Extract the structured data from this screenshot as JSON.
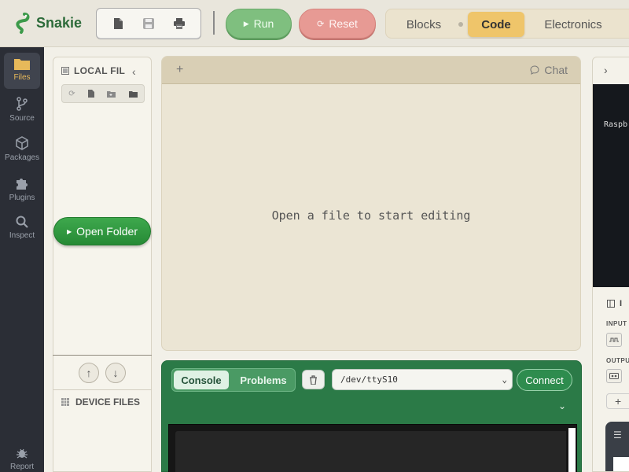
{
  "app": {
    "name": "Snakie"
  },
  "toolbar": {
    "new_icon": "new-file-icon",
    "save_icon": "save-icon",
    "print_icon": "print-icon",
    "run_label": "Run",
    "reset_label": "Reset"
  },
  "modes": {
    "items": [
      "Blocks",
      "Code",
      "Electronics"
    ],
    "active": "Code"
  },
  "activity": {
    "items": [
      {
        "label": "Files",
        "icon": "folder-icon",
        "active": true
      },
      {
        "label": "Source",
        "icon": "branch-icon"
      },
      {
        "label": "Packages",
        "icon": "package-icon"
      },
      {
        "label": "Plugins",
        "icon": "puzzle-icon"
      },
      {
        "label": "Inspect",
        "icon": "search-icon"
      },
      {
        "label": "Report",
        "icon": "bug-icon"
      }
    ]
  },
  "local_files": {
    "title": "LOCAL FIL",
    "open_folder_label": "Open Folder",
    "device_files_title": "DEVICE FILES"
  },
  "editor": {
    "add_tab": "+",
    "chat_label": "Chat",
    "empty_message": "Open a file to start editing"
  },
  "console": {
    "tabs": [
      "Console",
      "Problems"
    ],
    "active_tab": "Console",
    "port": "/dev/ttyS10",
    "connect_label": "Connect"
  },
  "right_panel": {
    "device_text": "Raspb",
    "section_title": "I",
    "input_label": "INPUT",
    "output_label": "OUTPU"
  },
  "colors": {
    "brand_green": "#2d6b3a",
    "accent_gold": "#efc56a",
    "console_green": "#2b7a47"
  }
}
